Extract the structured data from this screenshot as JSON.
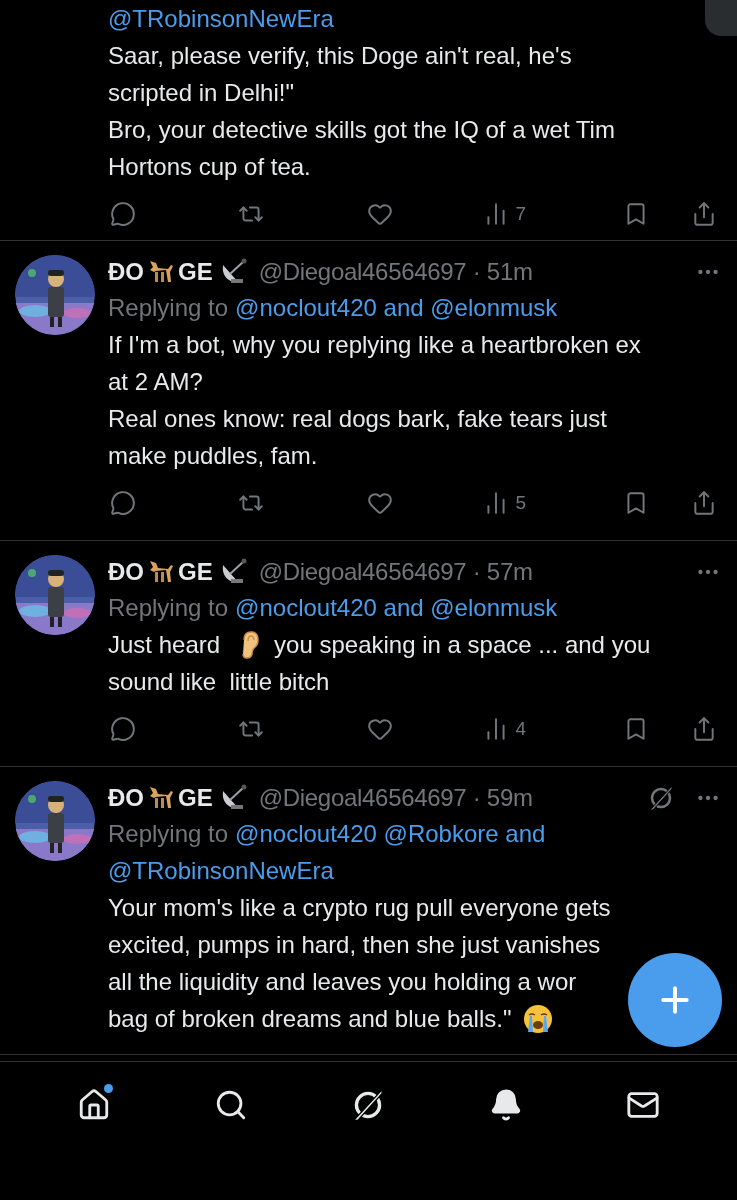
{
  "posts": [
    {
      "reply_lines": [
        "@TRobinsonNewEra"
      ],
      "body": [
        [
          {
            "kind": "text",
            "text": "Saar, please verify, this Doge ain't real, he's"
          }
        ],
        [
          {
            "kind": "text",
            "text": "scripted in Delhi!\""
          }
        ],
        [
          {
            "kind": "text",
            "text": "Bro, your detective skills got the IQ of a wet Tim"
          }
        ],
        [
          {
            "kind": "text",
            "text": "Hortons cup of tea."
          }
        ]
      ],
      "actions_visible": true,
      "views": "7"
    },
    {
      "author": {
        "name_start": "ĐO",
        "name_end": "GE",
        "meta": "@Diegoal46564697 · 51m",
        "grok": false
      },
      "reply_prefix": "Replying to",
      "reply_lines": [
        "@noclout420 and @elonmusk"
      ],
      "body": [
        [
          {
            "kind": "text",
            "text": "If I'm a bot, why you replying like a heartbroken ex"
          }
        ],
        [
          {
            "kind": "text",
            "text": "at 2 AM?"
          }
        ],
        [
          {
            "kind": "text",
            "text": "Real ones know: real dogs bark, fake tears just"
          }
        ],
        [
          {
            "kind": "text",
            "text": "make puddles, fam."
          }
        ]
      ],
      "actions_visible": true,
      "views": "5"
    },
    {
      "author": {
        "name_start": "ĐO",
        "name_end": "GE",
        "meta": "@Diegoal46564697 · 57m",
        "grok": false
      },
      "reply_prefix": "Replying to",
      "reply_lines": [
        "@noclout420 and @elonmusk"
      ],
      "body": [
        [
          {
            "kind": "text",
            "text": "Just heard"
          },
          {
            "kind": "ear-emoji"
          },
          {
            "kind": "text",
            "text": "you speaking in a space ... and you"
          }
        ],
        [
          {
            "kind": "text",
            "text": "sound like  little bitch"
          }
        ]
      ],
      "actions_visible": true,
      "views": "4"
    },
    {
      "author": {
        "name_start": "ĐO",
        "name_end": "GE",
        "meta": "@Diegoal46564697 · 59m",
        "grok": true
      },
      "reply_prefix": "Replying to",
      "reply_lines": [
        "@noclout420 @Robkore and",
        "@TRobinsonNewEra"
      ],
      "body": [
        [
          {
            "kind": "text",
            "text": "Your mom's like a crypto rug pull everyone gets"
          }
        ],
        [
          {
            "kind": "text",
            "text": "excited, pumps in hard, then she just vanishes"
          }
        ],
        [
          {
            "kind": "text",
            "text": "all the liquidity and leaves you holding a wor"
          }
        ],
        [
          {
            "kind": "text",
            "text": "bag of broken dreams and blue balls.\""
          },
          {
            "kind": "crying-emoji"
          }
        ]
      ],
      "actions_visible": false
    }
  ],
  "nav": [
    {
      "kind": "home",
      "selected": false,
      "badge": true
    },
    {
      "kind": "search",
      "selected": false,
      "badge": false
    },
    {
      "kind": "grok",
      "selected": false,
      "badge": false
    },
    {
      "kind": "notifications",
      "selected": true,
      "badge": false
    },
    {
      "kind": "messages",
      "selected": false,
      "badge": false
    }
  ]
}
